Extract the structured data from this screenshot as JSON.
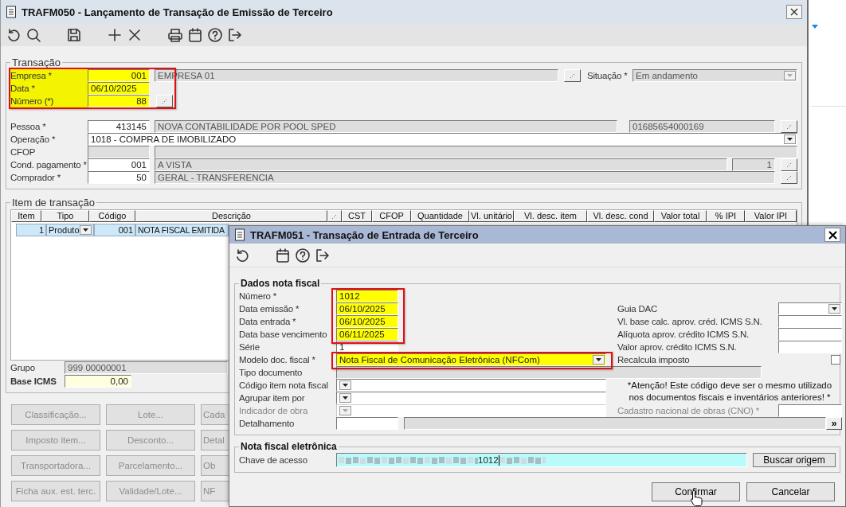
{
  "main_window": {
    "title": "TRAFM050 - Lançamento de Transação de Emissão de Terceiro"
  },
  "transacao": {
    "legend": "Transação",
    "rows": [
      {
        "label": "Empresa *",
        "highlighted": true,
        "parts": [
          {
            "kind": "code",
            "value": "001"
          },
          {
            "kind": "name",
            "value": "EMPRESA 01"
          },
          {
            "kind": "lookup"
          },
          {
            "kind": "label",
            "value": "Situação *"
          },
          {
            "kind": "status-select",
            "value": "Em andamento"
          }
        ]
      },
      {
        "label": "Data *",
        "highlighted": true,
        "parts": [
          {
            "kind": "date",
            "value": "06/10/2025"
          }
        ]
      },
      {
        "label": "Número (*)",
        "highlighted": true,
        "parts": [
          {
            "kind": "code",
            "value": "88"
          },
          {
            "kind": "lookup"
          }
        ]
      },
      {
        "label": "Pessoa *",
        "highlighted": false,
        "parts": [
          {
            "kind": "code",
            "value": "413145"
          },
          {
            "kind": "name",
            "value": "NOVA CONTABILIDADE POR POOL SPED"
          },
          {
            "kind": "document",
            "value": "01685654000169"
          },
          {
            "kind": "lookup"
          }
        ]
      },
      {
        "label": "Operação *",
        "highlighted": false,
        "parts": [
          {
            "kind": "select",
            "value": "1018 - COMPRA DE IMOBILIZADO"
          }
        ]
      },
      {
        "label": "CFOP",
        "highlighted": false,
        "parts": [
          {
            "kind": "code",
            "disabled": true
          },
          {
            "kind": "name"
          }
        ]
      },
      {
        "label": "Cond. pagamento *",
        "highlighted": false,
        "parts": [
          {
            "kind": "code",
            "value": "001"
          },
          {
            "kind": "name",
            "value": "A VISTA"
          },
          {
            "kind": "count",
            "value": "1"
          },
          {
            "kind": "lookup"
          }
        ]
      },
      {
        "label": "Comprador *",
        "highlighted": false,
        "parts": [
          {
            "kind": "code",
            "value": "50"
          },
          {
            "kind": "name",
            "value": "GERAL - TRANSFERENCIA"
          },
          {
            "kind": "lookup"
          }
        ]
      }
    ]
  },
  "itens": {
    "legend": "Item de transação",
    "columns": [
      {
        "label": "Item"
      },
      {
        "label": "Tipo"
      },
      {
        "label": "Código"
      },
      {
        "label": "Descrição"
      },
      {
        "kind": "lookup"
      },
      {
        "label": "CST"
      },
      {
        "label": "CFOP"
      },
      {
        "label": "Quantidade"
      },
      {
        "label": "Vl. unitário"
      },
      {
        "label": "Vl. desc. item"
      },
      {
        "label": "Vl. desc. cond"
      },
      {
        "label": "Valor total"
      },
      {
        "label": "% IPI"
      },
      {
        "label": "Valor IPI"
      }
    ],
    "rows": [
      {
        "selected": true,
        "cells": [
          "1",
          "Produto",
          "001",
          "NOTA FISCAL EMITIDA"
        ]
      }
    ],
    "grupo": {
      "label": "Grupo",
      "value": "999 00000001"
    },
    "base_icms": {
      "label": "Base ICMS",
      "value": "0,00"
    }
  },
  "buttons": [
    {
      "label": "Classificação...",
      "disabled": true
    },
    {
      "label": "Lote...",
      "disabled": true
    },
    {
      "label": "Cada",
      "disabled": true
    },
    {
      "label": "Imposto item...",
      "disabled": true
    },
    {
      "label": "Desconto...",
      "disabled": true
    },
    {
      "label": "Detal",
      "disabled": true
    },
    {
      "label": "Transportadora...",
      "disabled": true
    },
    {
      "label": "Parcelamento...",
      "disabled": true
    },
    {
      "label": "Ob",
      "disabled": true
    },
    {
      "label": "Ficha aux. est. terc.",
      "disabled": true
    },
    {
      "label": "Validade/Lote...",
      "disabled": true
    },
    {
      "label": "NF",
      "disabled": true
    }
  ],
  "dialog": {
    "title": "TRAFM051 - Transação de Entrada de Terceiro",
    "dados": {
      "legend": "Dados nota fiscal",
      "left_fields": [
        {
          "label": "Número *",
          "kind": "text",
          "value": "1012",
          "highlighted": true,
          "disabled": false
        },
        {
          "label": "Data emissão *",
          "kind": "text",
          "value": "06/10/2025",
          "highlighted": true,
          "disabled": false
        },
        {
          "label": "Data entrada *",
          "kind": "text",
          "value": "06/10/2025",
          "highlighted": true,
          "disabled": false
        },
        {
          "label": "Data base vencimento",
          "kind": "text",
          "value": "06/11/2025",
          "highlighted": true,
          "disabled": false
        },
        {
          "label": "Série",
          "kind": "text",
          "value": "1",
          "highlighted": false,
          "disabled": false
        },
        {
          "label": "Modelo doc. fiscal *",
          "kind": "select",
          "value": "Nota Fiscal de Comunicação Eletrônica (NFCom)",
          "highlighted": true,
          "disabled": false
        },
        {
          "label": "Tipo documento",
          "kind": "readonly",
          "highlighted": false,
          "disabled": false
        },
        {
          "label": "Código item nota fiscal",
          "kind": "select",
          "highlighted": false,
          "disabled": false
        },
        {
          "label": "Agrupar item por",
          "kind": "select",
          "highlighted": false,
          "disabled": false
        },
        {
          "label": "Indicador de obra",
          "kind": "select",
          "highlighted": false,
          "disabled": true
        },
        {
          "label": "Detalhamento",
          "kind": "detail",
          "button": "»",
          "highlighted": false,
          "disabled": false
        }
      ],
      "right_fields": [
        {
          "label": "Guia DAC",
          "kind": "select",
          "disabled": false
        },
        {
          "label": "Vl. base calc. aprov. créd. ICMS S.N.",
          "kind": "text",
          "disabled": false
        },
        {
          "label": "Alíquota aprov. crédito ICMS S.N.",
          "kind": "text",
          "disabled": false
        },
        {
          "label": "Valor aprov. crédito ICMS S.N.",
          "kind": "text",
          "disabled": false
        },
        {
          "label": "Recalcula imposto",
          "kind": "checkbox",
          "checked": false,
          "disabled": false
        },
        {
          "kind": "note",
          "lines": [
            "*Atenção! Este código deve ser o mesmo utilizado",
            "nos documentos fiscais e inventários anteriores! *"
          ],
          "disabled": false
        },
        {
          "label": "Cadastro nacional de obras (CNO) *",
          "kind": "text",
          "disabled": true
        }
      ]
    },
    "nfe": {
      "legend": "Nota fiscal eletrônica",
      "label": "Chave de acesso",
      "value": "1012",
      "button": "Buscar origem"
    },
    "actions": [
      "Confirmar",
      "Cancelar"
    ]
  }
}
